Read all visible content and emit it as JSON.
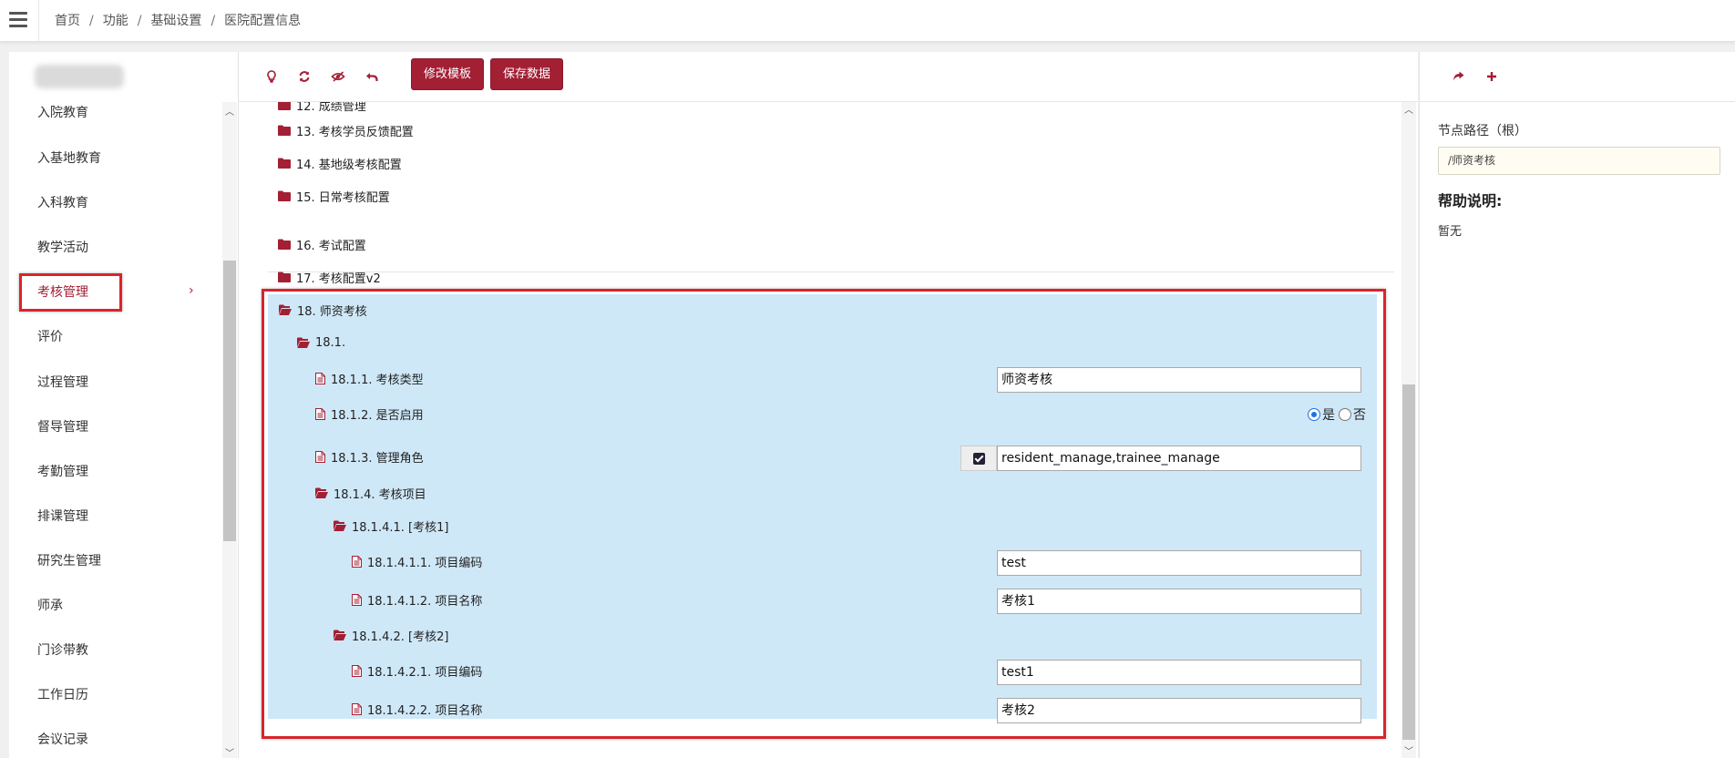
{
  "topbar": {
    "breadcrumb": [
      "首页",
      "功能",
      "基础设置",
      "医院配置信息"
    ],
    "separator": "/"
  },
  "sidebar": {
    "items": [
      {
        "label": "入院教育"
      },
      {
        "label": "入基地教育"
      },
      {
        "label": "入科教育"
      },
      {
        "label": "教学活动"
      },
      {
        "label": "考核管理",
        "active": true
      },
      {
        "label": "评价"
      },
      {
        "label": "过程管理"
      },
      {
        "label": "督导管理"
      },
      {
        "label": "考勤管理"
      },
      {
        "label": "排课管理"
      },
      {
        "label": "研究生管理"
      },
      {
        "label": "师承"
      },
      {
        "label": "门诊带教"
      },
      {
        "label": "工作日历"
      },
      {
        "label": "会议记录"
      }
    ],
    "active_arrow": "›"
  },
  "toolbar": {
    "icons": [
      "lightbulb-icon",
      "refresh-icon",
      "eye-slash-icon",
      "undo-icon"
    ],
    "edit_template": "修改模板",
    "save_data": "保存数据"
  },
  "tree": {
    "partial_top": "12. 成绩管理",
    "folders": [
      "13. 考核学员反馈配置",
      "14. 基地级考核配置",
      "15. 日常考核配置",
      "16. 考试配置",
      "17. 考核配置v2"
    ],
    "selected": {
      "root": "18. 师资考核",
      "sub": "18.1.",
      "n1": "18.1.1. 考核类型",
      "n1_value": "师资考核",
      "n2": "18.1.2. 是否启用",
      "n2_yes": "是",
      "n2_no": "否",
      "n2_selected": "是",
      "n3": "18.1.3. 管理角色",
      "n3_value": "resident_manage,trainee_manage",
      "n4": "18.1.4. 考核项目",
      "n41": "18.1.4.1. [考核1]",
      "n411": "18.1.4.1.1. 项目编码",
      "n411_value": "test",
      "n412": "18.1.4.1.2. 项目名称",
      "n412_value": "考核1",
      "n42": "18.1.4.2. [考核2]",
      "n421": "18.1.4.2.1. 项目编码",
      "n421_value": "test1",
      "n422": "18.1.4.2.2. 项目名称",
      "n422_value": "考核2"
    }
  },
  "right_panel": {
    "icons": [
      "share-icon",
      "plus-icon"
    ],
    "node_path_label": "节点路径（根）",
    "node_path_value": "/师资考核",
    "help_title": "帮助说明:",
    "help_text": "暂无"
  },
  "colors": {
    "brand": "#a31f34",
    "selection": "#cfe8f8",
    "highlight_border": "#d9242c"
  }
}
